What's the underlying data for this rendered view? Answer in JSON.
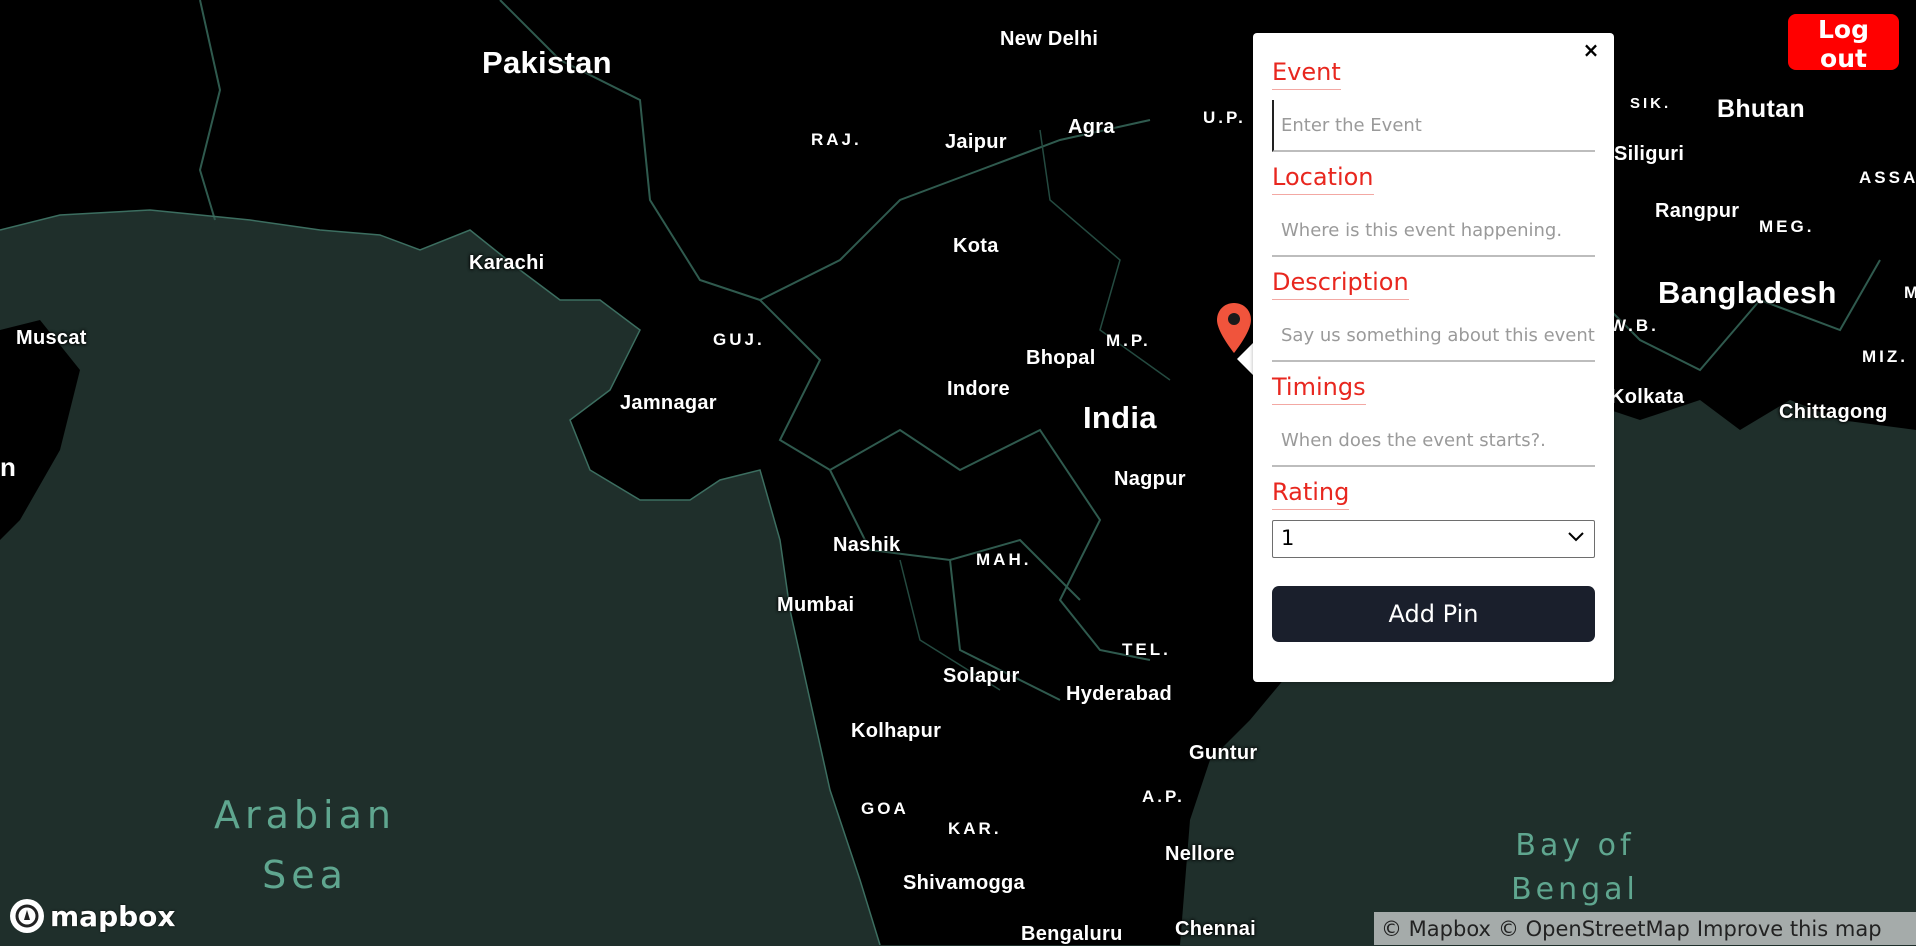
{
  "map": {
    "country_labels": [
      "Pakistan",
      "India",
      "Bhutan",
      "Bangladesh"
    ],
    "city_labels": [
      "New Delhi",
      "Jaipur",
      "Agra",
      "Kota",
      "Karachi",
      "Muscat",
      "Jamnagar",
      "Bhopal",
      "Indore",
      "Nagpur",
      "Nashik",
      "Mumbai",
      "Solapur",
      "Hyderabad",
      "Kolhapur",
      "Guntur",
      "Nellore",
      "Shivamogga",
      "Bengaluru",
      "Chennai",
      "Siliguri",
      "Rangpur",
      "Kolkata",
      "Chittagong"
    ],
    "state_labels": [
      "RAJ.",
      "U.P.",
      "GUJ.",
      "M.P.",
      "MAH.",
      "TEL.",
      "GOA",
      "KAR.",
      "A.P.",
      "SIK.",
      "MEG.",
      "ASSAN",
      "W.B.",
      "MIZ.",
      "M"
    ],
    "partial_label": "n",
    "water_labels": {
      "arabian_sea_line1": "Arabian",
      "arabian_sea_line2": "Sea",
      "bay_line1": "Bay of",
      "bay_line2": "Bengal"
    },
    "colors": {
      "land": "#000000",
      "water": "#1f2f2b",
      "border": "#2f5a4e"
    }
  },
  "marker": {
    "color": "#f0543c",
    "icon": "map-pin-icon"
  },
  "popup": {
    "close_label": "×",
    "fields": [
      {
        "label": "Event",
        "placeholder": "Enter the Event",
        "value": ""
      },
      {
        "label": "Location",
        "placeholder": "Where is this event happening.",
        "value": ""
      },
      {
        "label": "Description",
        "placeholder": "Say us something about this event",
        "value": ""
      },
      {
        "label": "Timings",
        "placeholder": "When does the event starts?.",
        "value": ""
      }
    ],
    "rating": {
      "label": "Rating",
      "selected": "1"
    },
    "submit_label": "Add Pin",
    "colors": {
      "label": "#e8271f",
      "button": "#1a1f2c"
    }
  },
  "header": {
    "logout_label": "Log out",
    "logout_color": "#ff0000"
  },
  "footer": {
    "logo_text": "mapbox",
    "attribution": [
      "© Mapbox",
      "© OpenStreetMap",
      "Improve this map"
    ]
  }
}
